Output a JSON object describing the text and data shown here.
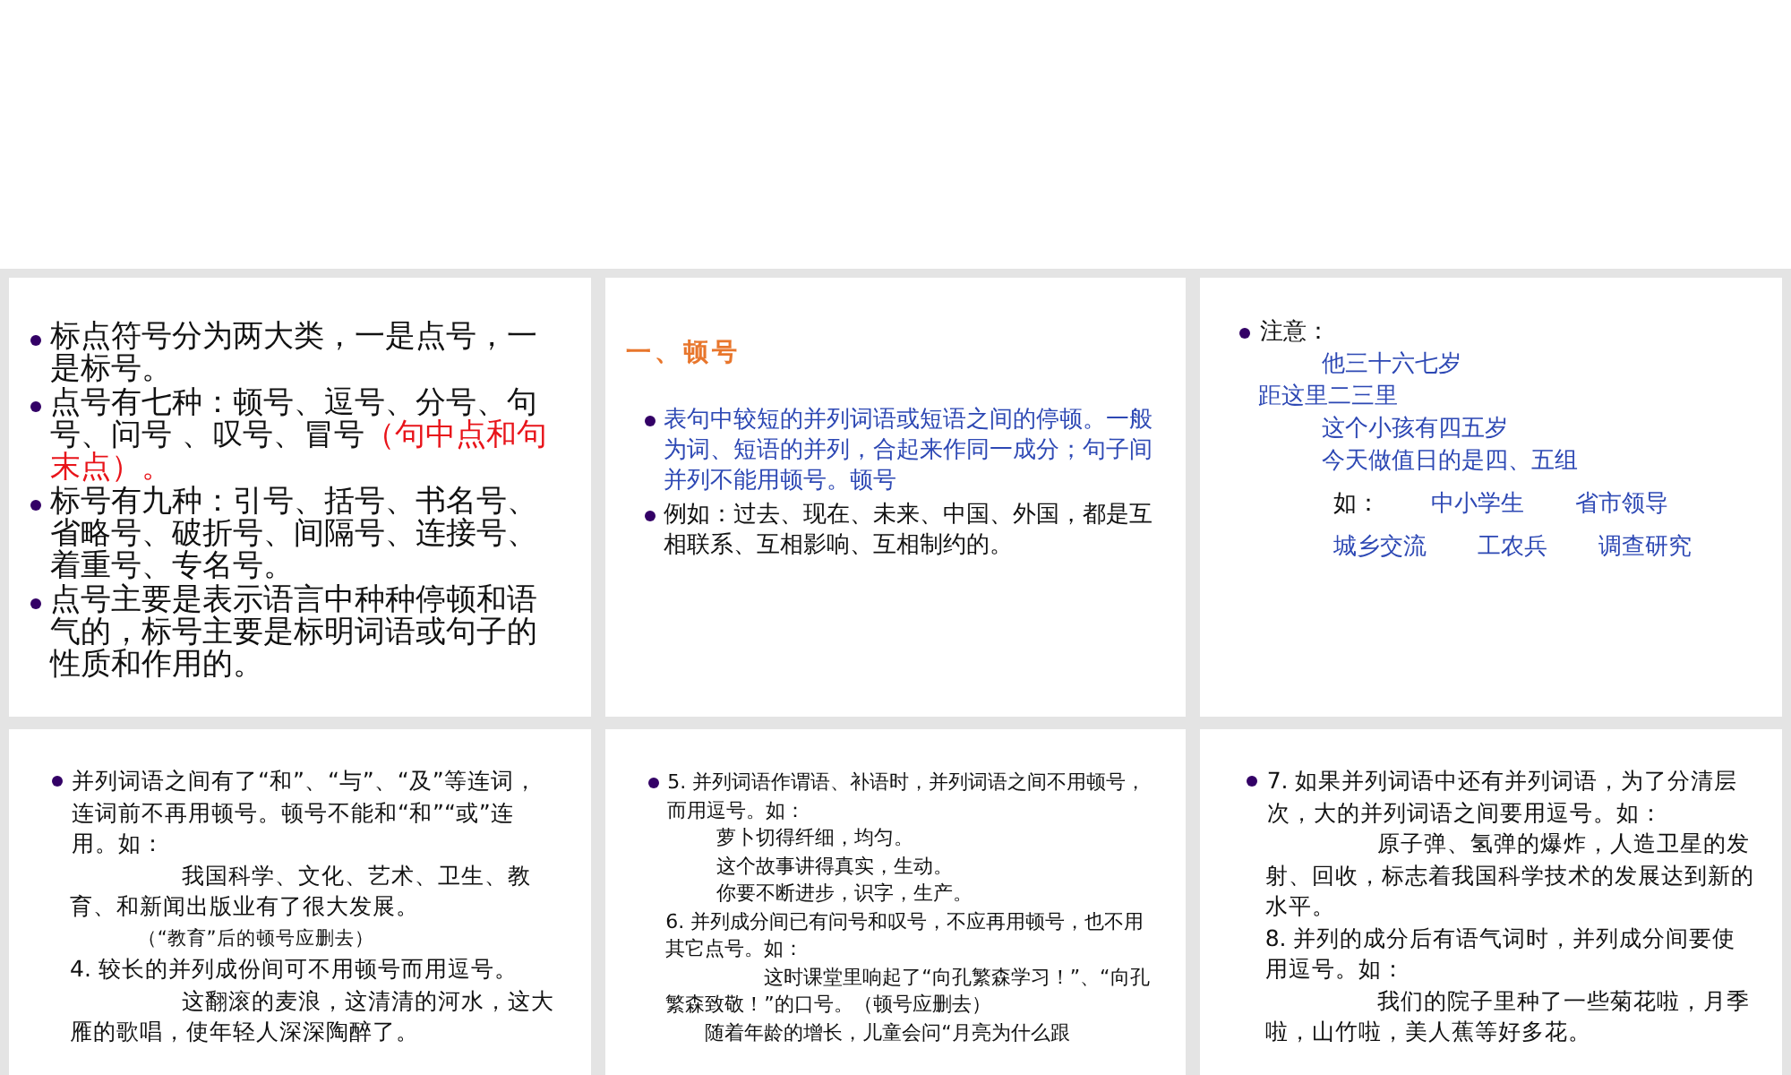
{
  "slides": [
    {
      "blocks": [
        {
          "kind": "bullet",
          "parts": [
            {
              "text": "标点符号分为两大类，一是点号，一是标号。"
            }
          ]
        },
        {
          "kind": "bullet",
          "parts": [
            {
              "text": "点号有七种：顿号、逗号、分号、句号、问号 、叹号、冒号"
            },
            {
              "text": "（句中点和句末点）。",
              "color": "#e8141a"
            }
          ]
        },
        {
          "kind": "bullet",
          "parts": [
            {
              "text": "标号有九种：引号、括号、书名号、省略号、破折号、间隔号、连接号、着重号、专名号。"
            }
          ]
        },
        {
          "kind": "bullet",
          "parts": [
            {
              "text": "点号主要是表示语言中种种停顿和语气的，标号主要是标明词语或句子的性质和作用的。"
            }
          ]
        }
      ]
    },
    {
      "blocks": [
        {
          "kind": "heading",
          "parts": [
            {
              "text": "一、顿号",
              "color": "#e8762c"
            }
          ]
        },
        {
          "kind": "bullet",
          "parts": [
            {
              "text": "表句中较短的并列词语或短语之间的停顿。一般为词、短语的并列，合起来作同一成分；句子间并列不能用顿号。顿号",
              "color": "#2d48b4"
            }
          ]
        },
        {
          "kind": "bullet",
          "parts": [
            {
              "text": "例如：过去、现在、未来、中国、外国，都是互相联系、互相影响、互相制约的。"
            }
          ]
        }
      ]
    },
    {
      "blocks": [
        {
          "kind": "bullet",
          "parts": [
            {
              "text": "注意："
            }
          ]
        },
        {
          "kind": "example",
          "parts": [
            {
              "text": "他三十六七岁",
              "color": "#2d48b4"
            }
          ]
        },
        {
          "kind": "line",
          "parts": [
            {
              "text": "距这里二三里",
              "color": "#2d48b4"
            }
          ]
        },
        {
          "kind": "example",
          "parts": [
            {
              "text": "这个小孩有四五岁",
              "color": "#2d48b4"
            }
          ]
        },
        {
          "kind": "example",
          "parts": [
            {
              "text": "今天做值日的是四、五组",
              "color": "#2d48b4"
            }
          ]
        },
        {
          "kind": "row",
          "parts": [
            {
              "text": "如："
            },
            {
              "text": "中小学生",
              "color": "#2d48b4"
            },
            {
              "text": "省市领导",
              "color": "#2d48b4"
            }
          ]
        },
        {
          "kind": "row",
          "parts": [
            {
              "text": "城乡交流",
              "color": "#2d48b4"
            },
            {
              "text": "工农兵",
              "color": "#2d48b4"
            },
            {
              "text": "调查研究",
              "color": "#2d48b4"
            }
          ]
        }
      ]
    },
    {
      "blocks": [
        {
          "kind": "bullet",
          "parts": [
            {
              "text": "并列词语之间有了“和”、“与”、“及”等连词，连词前不再用顿号。顿号不能和“和”“或”连用。如："
            }
          ]
        },
        {
          "kind": "indented",
          "parts": [
            {
              "text": "我国科学、文化、艺术、卫生、教育、和新闻出版业有了很大发展。"
            }
          ]
        },
        {
          "kind": "note",
          "parts": [
            {
              "text": "（“教育”后的顿号应删去）"
            }
          ]
        },
        {
          "kind": "line",
          "parts": [
            {
              "text": "4. 较长的并列成份间可不用顿号而用逗号。"
            }
          ]
        },
        {
          "kind": "indented",
          "parts": [
            {
              "text": "这翻滚的麦浪，这清清的河水，这大雁的歌唱，使年轻人深深陶醉了。"
            }
          ]
        }
      ]
    },
    {
      "blocks": [
        {
          "kind": "bullet",
          "parts": [
            {
              "text": "5. 并列词语作谓语、补语时，并列词语之间不用顿号，而用逗号。如："
            }
          ]
        },
        {
          "kind": "example",
          "parts": [
            {
              "text": "萝卜切得纤细，均匀。"
            }
          ]
        },
        {
          "kind": "example",
          "parts": [
            {
              "text": "这个故事讲得真实，生动。"
            }
          ]
        },
        {
          "kind": "example",
          "parts": [
            {
              "text": "你要不断进步，识字，生产。"
            }
          ]
        },
        {
          "kind": "line",
          "parts": [
            {
              "text": "6. 并列成分间已有问号和叹号，不应再用顿号，也不用其它点号。如："
            }
          ]
        },
        {
          "kind": "indented",
          "parts": [
            {
              "text": "这时课堂里响起了“向孔繁森学习！”、“向孔繁森致敬！”的口号。（顿号应删去）"
            }
          ]
        },
        {
          "kind": "lead",
          "parts": [
            {
              "text": "随着年龄的增长，儿童会问“月亮为什么跟"
            }
          ]
        }
      ]
    },
    {
      "blocks": [
        {
          "kind": "bullet",
          "parts": [
            {
              "text": "7. 如果并列词语中还有并列词语，为了分清层次，大的并列词语之间要用逗号。如："
            }
          ]
        },
        {
          "kind": "indented",
          "parts": [
            {
              "text": "原子弹、氢弹的爆炸，人造卫星的发射、回收，标志着我国科学技术的发展达到新的水平。"
            }
          ]
        },
        {
          "kind": "line",
          "parts": [
            {
              "text": "8. 并列的成分后有语气词时，并列成分间要使用逗号。如："
            }
          ]
        },
        {
          "kind": "indented",
          "parts": [
            {
              "text": "我们的院子里种了一些菊花啦，月季啦，山竹啦，美人蕉等好多花。"
            }
          ]
        }
      ]
    }
  ]
}
